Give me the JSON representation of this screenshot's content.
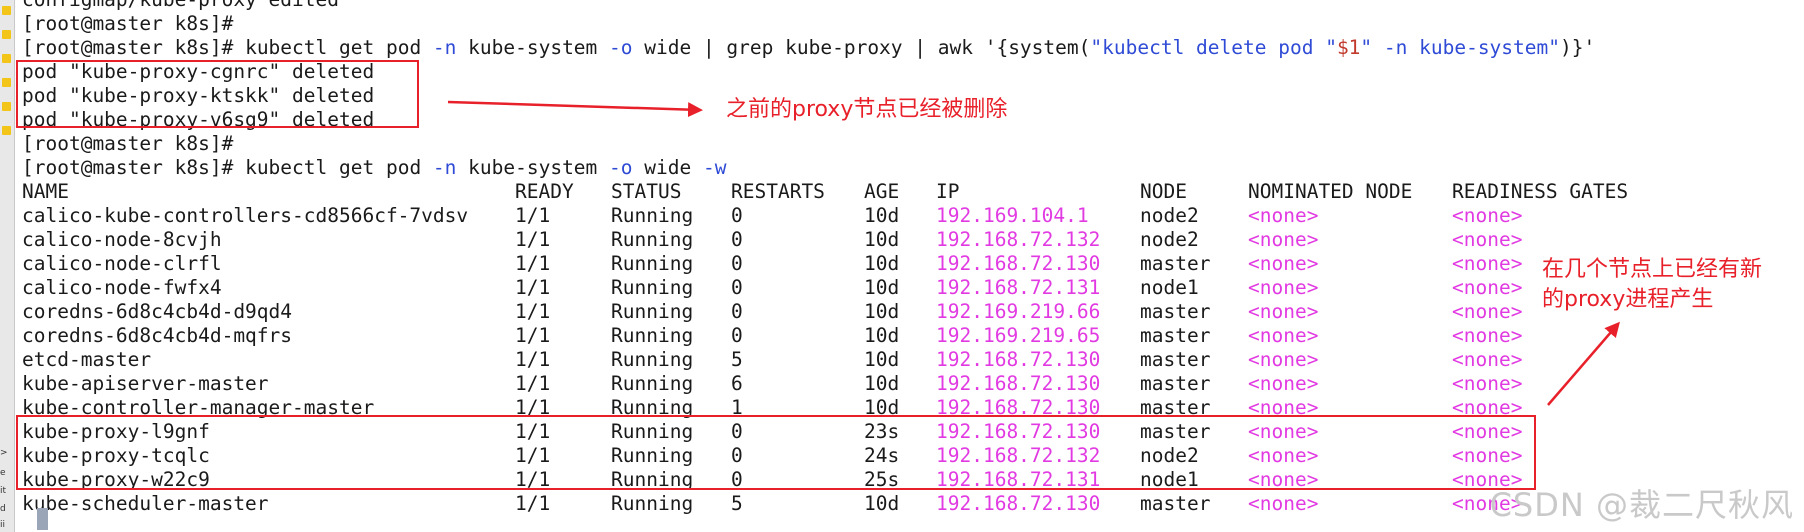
{
  "gutter": {
    "labels": [
      ">",
      "e",
      "it",
      "d",
      "ii"
    ]
  },
  "terminal": {
    "top_partial": "configmap/kube-proxy edited",
    "prompt": "[root@master k8s]#",
    "cmd1": {
      "a": "kubectl get pod ",
      "b": "-n",
      "c": " kube-system ",
      "d": "-o",
      "e": " wide | grep kube-proxy | awk '{system(",
      "f": "\"kubectl delete pod \"",
      "g": "$1",
      "h": "\" -n kube-system\"",
      "i": ")}'"
    },
    "deleted": [
      "pod \"kube-proxy-cgnrc\" deleted",
      "pod \"kube-proxy-ktskk\" deleted",
      "pod \"kube-proxy-v6sg9\" deleted"
    ],
    "cmd2": {
      "a": "kubectl get pod ",
      "b": "-n",
      "c": " kube-system ",
      "d": "-o",
      "e": " wide ",
      "f": "-w"
    },
    "headers": [
      "NAME",
      "READY",
      "STATUS",
      "RESTARTS",
      "AGE",
      "IP",
      "NODE",
      "NOMINATED NODE",
      "READINESS GATES"
    ],
    "pods": [
      {
        "name": "calico-kube-controllers-cd8566cf-7vdsv",
        "ready": "1/1",
        "status": "Running",
        "restarts": "0",
        "age": "10d",
        "ip": "192.169.104.1",
        "node": "node2",
        "nominated": "<none>",
        "gates": "<none>"
      },
      {
        "name": "calico-node-8cvjh",
        "ready": "1/1",
        "status": "Running",
        "restarts": "0",
        "age": "10d",
        "ip": "192.168.72.132",
        "node": "node2",
        "nominated": "<none>",
        "gates": "<none>"
      },
      {
        "name": "calico-node-clrfl",
        "ready": "1/1",
        "status": "Running",
        "restarts": "0",
        "age": "10d",
        "ip": "192.168.72.130",
        "node": "master",
        "nominated": "<none>",
        "gates": "<none>"
      },
      {
        "name": "calico-node-fwfx4",
        "ready": "1/1",
        "status": "Running",
        "restarts": "0",
        "age": "10d",
        "ip": "192.168.72.131",
        "node": "node1",
        "nominated": "<none>",
        "gates": "<none>"
      },
      {
        "name": "coredns-6d8c4cb4d-d9qd4",
        "ready": "1/1",
        "status": "Running",
        "restarts": "0",
        "age": "10d",
        "ip": "192.169.219.66",
        "node": "master",
        "nominated": "<none>",
        "gates": "<none>"
      },
      {
        "name": "coredns-6d8c4cb4d-mqfrs",
        "ready": "1/1",
        "status": "Running",
        "restarts": "0",
        "age": "10d",
        "ip": "192.169.219.65",
        "node": "master",
        "nominated": "<none>",
        "gates": "<none>"
      },
      {
        "name": "etcd-master",
        "ready": "1/1",
        "status": "Running",
        "restarts": "5",
        "age": "10d",
        "ip": "192.168.72.130",
        "node": "master",
        "nominated": "<none>",
        "gates": "<none>"
      },
      {
        "name": "kube-apiserver-master",
        "ready": "1/1",
        "status": "Running",
        "restarts": "6",
        "age": "10d",
        "ip": "192.168.72.130",
        "node": "master",
        "nominated": "<none>",
        "gates": "<none>"
      },
      {
        "name": "kube-controller-manager-master",
        "ready": "1/1",
        "status": "Running",
        "restarts": "1",
        "age": "10d",
        "ip": "192.168.72.130",
        "node": "master",
        "nominated": "<none>",
        "gates": "<none>"
      },
      {
        "name": "kube-proxy-l9gnf",
        "ready": "1/1",
        "status": "Running",
        "restarts": "0",
        "age": "23s",
        "ip": "192.168.72.130",
        "node": "master",
        "nominated": "<none>",
        "gates": "<none>"
      },
      {
        "name": "kube-proxy-tcqlc",
        "ready": "1/1",
        "status": "Running",
        "restarts": "0",
        "age": "24s",
        "ip": "192.168.72.132",
        "node": "node2",
        "nominated": "<none>",
        "gates": "<none>"
      },
      {
        "name": "kube-proxy-w22c9",
        "ready": "1/1",
        "status": "Running",
        "restarts": "0",
        "age": "25s",
        "ip": "192.168.72.131",
        "node": "node1",
        "nominated": "<none>",
        "gates": "<none>"
      },
      {
        "name": "kube-scheduler-master",
        "ready": "1/1",
        "status": "Running",
        "restarts": "5",
        "age": "10d",
        "ip": "192.168.72.130",
        "node": "master",
        "nominated": "<none>",
        "gates": "<none>"
      }
    ]
  },
  "annotations": {
    "deleted_note": "之前的proxy节点已经被删除",
    "new_note_line1": "在几个节点上已经有新",
    "new_note_line2": "的proxy进程产生",
    "color": "#e8202a"
  },
  "watermark": "CSDN @裁二尺秋风"
}
